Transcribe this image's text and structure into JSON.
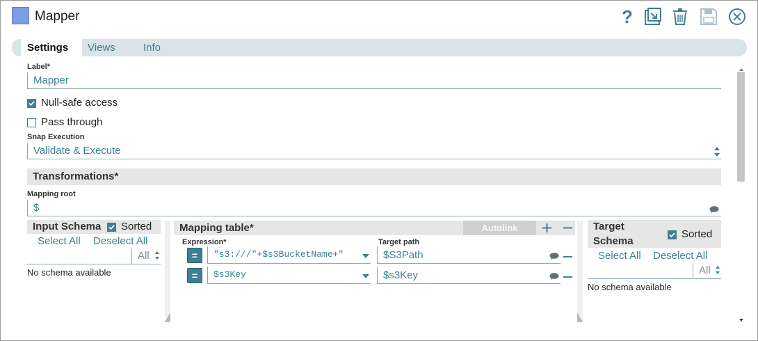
{
  "window": {
    "title": "Mapper"
  },
  "header_icons": [
    "help-icon",
    "export-icon",
    "delete-icon",
    "save-icon",
    "close-icon"
  ],
  "tabs": [
    {
      "label": "Settings",
      "active": true
    },
    {
      "label": "Views",
      "active": false
    },
    {
      "label": "Info",
      "active": false
    }
  ],
  "settings": {
    "label_title": "Label*",
    "label_value": "Mapper",
    "null_safe_label": "Null-safe access",
    "null_safe_checked": true,
    "pass_through_label": "Pass through",
    "pass_through_checked": false,
    "snap_execution_title": "Snap Execution",
    "snap_execution_value": "Validate & Execute",
    "transformations_title": "Transformations*",
    "mapping_root_title": "Mapping root",
    "mapping_root_value": "$"
  },
  "input_schema": {
    "title": "Input Schema",
    "sorted_label": "Sorted",
    "sorted_checked": true,
    "select_all": "Select All",
    "deselect_all": "Deselect All",
    "filter_value": "All",
    "empty_text": "No schema available"
  },
  "mapping_table": {
    "title": "Mapping table*",
    "autolink": "Autolink",
    "expression_header": "Expression*",
    "target_header": "Target path",
    "rows": [
      {
        "expression": "\"s3:///\"+$s3BucketName+\"",
        "target": "$S3Path"
      },
      {
        "expression": "$s3Key",
        "target": "$s3Key"
      }
    ]
  },
  "target_schema": {
    "title_line1": "Target",
    "title_line2": "Schema",
    "sorted_label": "Sorted",
    "sorted_checked": true,
    "select_all": "Select All",
    "deselect_all": "Deselect All",
    "filter_value": "All",
    "empty_text": "No schema available"
  },
  "colors": {
    "accent": "#3f7f95",
    "tab_bar": "#d8e4e8",
    "section_bg": "#e6e6e6",
    "app_icon": "#7b9ee3"
  }
}
